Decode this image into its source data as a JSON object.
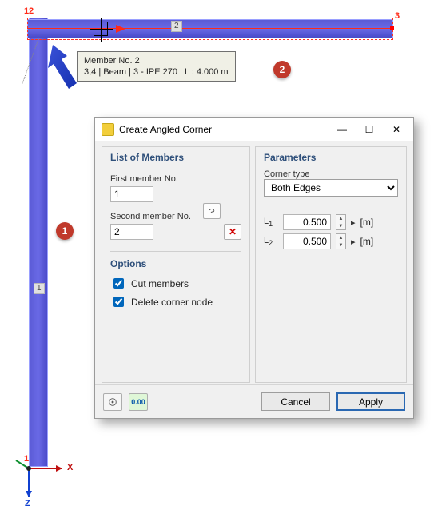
{
  "viewport": {
    "tooltip_line1": "Member No. 2",
    "tooltip_line2": "3,4 | Beam | 3 - IPE 270 | L : 4.000 m",
    "node_labels": {
      "n1top": "1",
      "n2top": "2",
      "n3": "3",
      "n1bot": "1"
    },
    "member_labels": {
      "horizontal": "2",
      "vertical": "1"
    },
    "axes": {
      "x": "X",
      "z": "Z"
    },
    "callouts": {
      "c1": "1",
      "c2": "2"
    }
  },
  "dialog": {
    "title": "Create Angled Corner",
    "groups": {
      "members": "List of Members",
      "params": "Parameters",
      "options": "Options"
    },
    "labels": {
      "first_member": "First member No.",
      "second_member": "Second member No.",
      "corner_type": "Corner type",
      "L1": "L",
      "L1_sub": "1",
      "L2": "L",
      "L2_sub": "2",
      "unit": "[m]",
      "cut_members": "Cut members",
      "delete_node": "Delete corner node"
    },
    "values": {
      "first_member": "1",
      "second_member": "2",
      "corner_type_selected": "Both Edges",
      "L1": "0.500",
      "L2": "0.500",
      "cut_members_checked": true,
      "delete_node_checked": true
    },
    "buttons": {
      "cancel": "Cancel",
      "apply": "Apply"
    },
    "footer_tool_text": "0.00"
  }
}
